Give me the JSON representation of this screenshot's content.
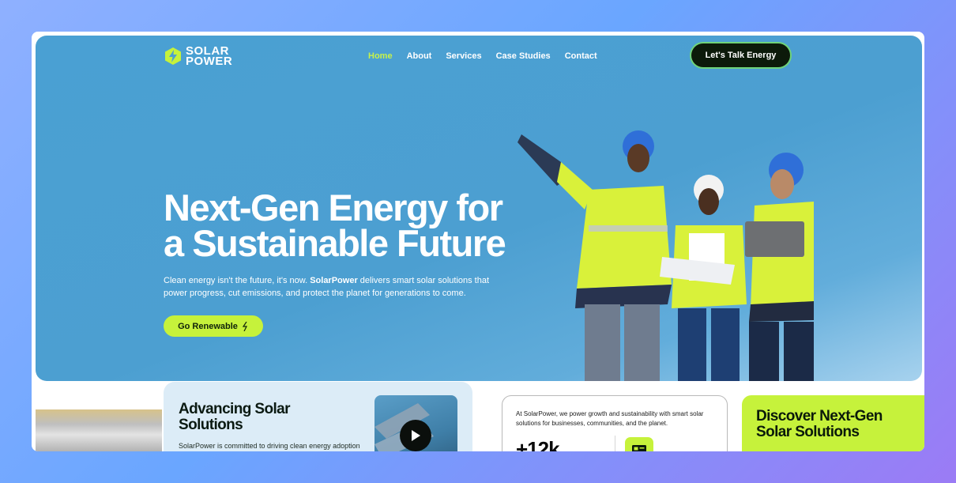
{
  "brand": {
    "line1": "SOLAR",
    "line2": "POWER"
  },
  "nav": {
    "items": [
      {
        "label": "Home",
        "active": true
      },
      {
        "label": "About",
        "active": false
      },
      {
        "label": "Services",
        "active": false
      },
      {
        "label": "Case Studies",
        "active": false
      },
      {
        "label": "Contact",
        "active": false
      }
    ],
    "cta": "Let's Talk Energy"
  },
  "hero": {
    "headline_line1": "Next-Gen Energy for",
    "headline_line2": "a Sustainable Future",
    "sub_part1": "Clean energy isn't the future, it's now. ",
    "sub_brand": "SolarPower",
    "sub_part2": " delivers smart solar solutions that power progress, cut emissions, and protect the planet for generations to come.",
    "button": "Go Renewable",
    "button_icon": "bolt-icon"
  },
  "advancing": {
    "title_line1": "Advancing Solar",
    "title_line2": "Solutions",
    "text": "SolarPower is committed to driving clean energy adoption",
    "video_icon": "play-icon"
  },
  "stats": {
    "text": "At SolarPower, we power growth and sustainability with smart solar solutions for businesses, communities, and the planet.",
    "number": "+12k",
    "icon": "id-card-icon"
  },
  "discover": {
    "title_line1": "Discover Next-Gen",
    "title_line2": "Solar Solutions"
  },
  "colors": {
    "accent": "#c6f23b",
    "hero_blue": "#4c9fd1",
    "dark": "#0c1a0a"
  }
}
